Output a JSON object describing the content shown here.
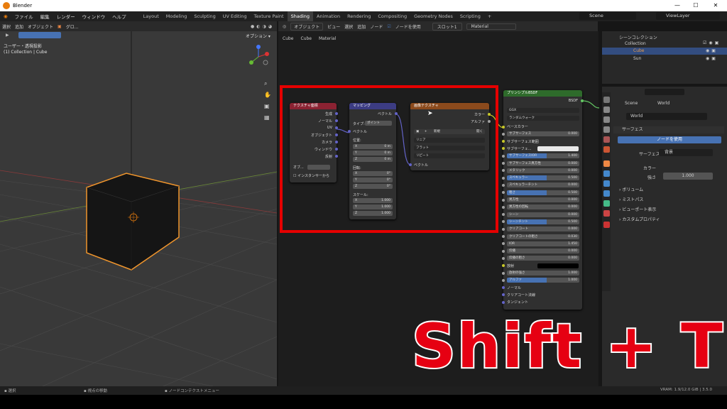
{
  "app": {
    "title": "Blender"
  },
  "menu": [
    "ファイル",
    "編集",
    "レンダー",
    "ウィンドウ",
    "ヘルプ"
  ],
  "workspaces": [
    "Layout",
    "Modeling",
    "Sculpting",
    "UV Editing",
    "Texture Paint",
    "Shading",
    "Animation",
    "Rendering",
    "Compositing",
    "Geometry Nodes",
    "Scripting"
  ],
  "active_workspace": "Shading",
  "top_right": {
    "scene": "Scene",
    "view_layer": "ViewLayer"
  },
  "viewport": {
    "header": [
      "選択",
      "追加",
      "オブジェクト",
      "グロ..."
    ],
    "options": "オプション ▾",
    "view_name": "ユーザー・透視投影",
    "collection_line": "(1) Collection | Cube"
  },
  "node_editor": {
    "header": [
      "オブジェクト",
      "ビュー",
      "選択",
      "追加",
      "ノード"
    ],
    "use_nodes_label": "ノードを使用",
    "slot": "スロット1",
    "material": "Material",
    "breadcrumb": [
      "Cube",
      "Cube",
      "Material"
    ]
  },
  "nodes": {
    "texcoord": {
      "title": "テクスチャ座標",
      "outputs": [
        "生成",
        "ノーマル",
        "UV",
        "オブジェクト",
        "カメラ",
        "ウィンドウ",
        "反射"
      ],
      "object_label": "オブ...",
      "instancer": "インスタンサーから"
    },
    "mapping": {
      "title": "マッピング",
      "output": "ベクトル",
      "type_label": "タイプ:",
      "type_value": "ポイント",
      "vector": "ベクトル",
      "location": "位置:",
      "loc": [
        [
          "X",
          "0 m"
        ],
        [
          "Y",
          "0 m"
        ],
        [
          "Z",
          "0 m"
        ]
      ],
      "rotation": "回転:",
      "rot": [
        [
          "X",
          "0°"
        ],
        [
          "Y",
          "0°"
        ],
        [
          "Z",
          "0°"
        ]
      ],
      "scale": "スケール:",
      "scl": [
        [
          "X",
          "1.000"
        ],
        [
          "Y",
          "1.000"
        ],
        [
          "Z",
          "1.000"
        ]
      ]
    },
    "image": {
      "title": "画像テクスチャ",
      "outputs": [
        "カラー",
        "アルファ"
      ],
      "new_btn": "新規",
      "open_btn": "開く",
      "interp": "リニア",
      "proj": "フラット",
      "ext": "リピート",
      "vector": "ベクトル"
    },
    "bsdf": {
      "title": "プリンシプルBSDF",
      "output": "BSDF",
      "dist": "GGX",
      "sss_method": "ランダムウォーク",
      "rows": [
        [
          "ベースカラー",
          ""
        ],
        [
          "サブサーフェス",
          "0.000"
        ],
        [
          "サブサーフェス範囲",
          ""
        ],
        [
          "サブサーフェ...",
          ""
        ],
        [
          "サブサーフェスIOR",
          "1.400"
        ],
        [
          "サブサーフェス異方性",
          "0.000"
        ],
        [
          "メタリック",
          "0.000"
        ],
        [
          "スペキュラー",
          "0.500"
        ],
        [
          "スペキュラーチント",
          "0.000"
        ],
        [
          "粗さ",
          "0.500"
        ],
        [
          "異方性",
          "0.000"
        ],
        [
          "異方性の回転",
          "0.000"
        ],
        [
          "シーン",
          "0.000"
        ],
        [
          "シーンチント",
          "0.500"
        ],
        [
          "クリアコート",
          "0.000"
        ],
        [
          "クリアコートの粗さ",
          "0.030"
        ],
        [
          "IOR",
          "1.450"
        ],
        [
          "伝播",
          "0.000"
        ],
        [
          "伝播の粗さ",
          "0.000"
        ],
        [
          "放射",
          ""
        ],
        [
          "放射の強さ",
          "1.000"
        ],
        [
          "アルファ",
          "1.000"
        ],
        [
          "ノーマル",
          ""
        ],
        [
          "クリアコート法線",
          ""
        ],
        [
          "タンジェント",
          ""
        ]
      ]
    }
  },
  "outliner": {
    "title": "シーンコレクション",
    "items": [
      "Collection",
      "Cube",
      "Sun"
    ]
  },
  "properties": {
    "scene": "Scene",
    "world_bc": "World",
    "world_field": "World",
    "surface_panel": "サーフェス",
    "use_nodes": "ノードを使用",
    "surface_label": "サーフェス",
    "surface_value": "背景",
    "color_label": "カラー",
    "strength_label": "強さ",
    "strength_value": "1.000",
    "panels": [
      "ボリューム",
      "ミストパス",
      "ビューポート表示",
      "カスタムプロパティ"
    ]
  },
  "status": {
    "select": "選択",
    "move": "視点の移動",
    "context": "ノードコンテクストメニュー",
    "vram": "VRAM: 1.9/12.0 GiB | 3.5.0"
  },
  "overlay_text": "Shift + T",
  "colors": {
    "accent": "#e60012",
    "node_tex": "#8b2232",
    "node_vec": "#3c3c83",
    "node_img": "#8b4a1c",
    "node_shader": "#2e6b2b",
    "highlight_blue": "#4772b3",
    "selection_orange": "#f0952c"
  }
}
